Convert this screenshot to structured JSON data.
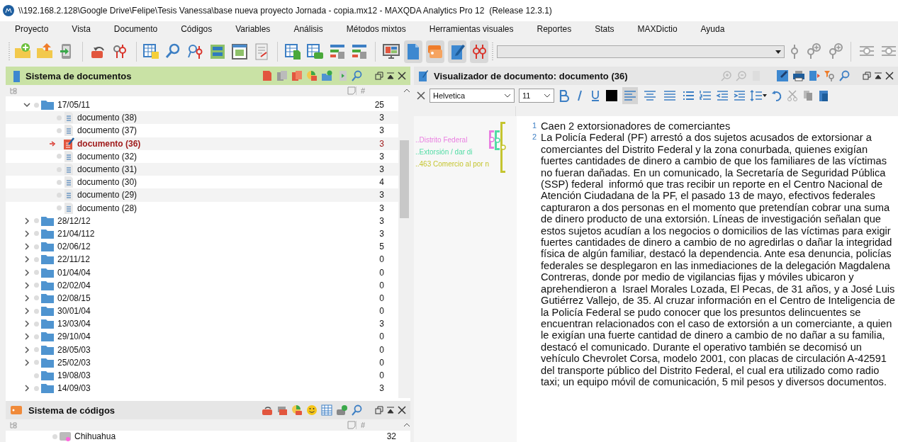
{
  "window": {
    "title": "\\\\192.168.2.128\\Google Drive\\Felipe\\Tesis Vanessa\\base nueva proyecto Jornada - copia.mx12 - MAXQDA Analytics Pro 12  (Release 12.3.1)"
  },
  "menu": [
    "Proyecto",
    "Vista",
    "Documento",
    "Códigos",
    "Variables",
    "Análisis",
    "Métodos mixtos",
    "Herramientas visuales",
    "Reportes",
    "Stats",
    "MAXDictio",
    "Ayuda"
  ],
  "document_system": {
    "title": "Sistema de documentos",
    "count_header": "#",
    "tree": [
      {
        "label": "17/05/11",
        "count": "25",
        "expanded": true,
        "has_children": true,
        "children": [
          {
            "label": "documento (38)",
            "count": "3",
            "active": false
          },
          {
            "label": "documento (37)",
            "count": "3",
            "active": false
          },
          {
            "label": "documento (36)",
            "count": "3",
            "active": true
          },
          {
            "label": "documento (32)",
            "count": "3",
            "active": false
          },
          {
            "label": "documento (31)",
            "count": "3",
            "active": false
          },
          {
            "label": "documento (30)",
            "count": "4",
            "active": false
          },
          {
            "label": "documento (29)",
            "count": "3",
            "active": false
          },
          {
            "label": "documento (28)",
            "count": "3",
            "active": false
          }
        ]
      },
      {
        "label": "28/12/12",
        "count": "3",
        "expanded": false,
        "has_children": true
      },
      {
        "label": "21/04/112",
        "count": "3",
        "expanded": false,
        "has_children": true
      },
      {
        "label": "02/06/12",
        "count": "5",
        "expanded": false,
        "has_children": true
      },
      {
        "label": "22/11/12",
        "count": "0",
        "expanded": false,
        "has_children": true
      },
      {
        "label": "01/04/04",
        "count": "0",
        "expanded": false,
        "has_children": true
      },
      {
        "label": "02/02/04",
        "count": "0",
        "expanded": false,
        "has_children": true
      },
      {
        "label": "02/08/15",
        "count": "0",
        "expanded": false,
        "has_children": true
      },
      {
        "label": "30/01/04",
        "count": "0",
        "expanded": false,
        "has_children": true
      },
      {
        "label": "13/03/04",
        "count": "3",
        "expanded": false,
        "has_children": true
      },
      {
        "label": "29/10/04",
        "count": "0",
        "expanded": false,
        "has_children": true
      },
      {
        "label": "28/05/03",
        "count": "0",
        "expanded": false,
        "has_children": true
      },
      {
        "label": "25/02/03",
        "count": "0",
        "expanded": false,
        "has_children": true
      },
      {
        "label": "19/08/03",
        "count": "0",
        "expanded": false,
        "has_children": false
      },
      {
        "label": "14/09/03",
        "count": "3",
        "expanded": false,
        "has_children": true
      }
    ]
  },
  "code_system": {
    "title": "Sistema de códigos",
    "count_header": "#",
    "tree": [
      {
        "label": "Chihuahua",
        "count": "32"
      }
    ]
  },
  "viewer": {
    "title": "Visualizador de documento: documento (36)",
    "font": "Helvetica",
    "size": "11",
    "alignments": [
      {
        "kind": "left",
        "selected": true
      },
      {
        "kind": "center",
        "selected": false
      },
      {
        "kind": "justify",
        "selected": false
      }
    ],
    "codes": [
      {
        "label": "..Distrito Federal",
        "color": "#e97fe0"
      },
      {
        "label": "..Extorsión / dar di",
        "color": "#52dca5"
      },
      {
        "label": "..463 Comercio al por n",
        "color": "#c5c530"
      }
    ],
    "paragraphs": [
      {
        "number": "1",
        "text": "Caen 2 extorsionadores de comerciantes"
      },
      {
        "number": "2",
        "text": "La Policía Federal (PF) arrestó a dos sujetos acusados de extorsionar a comerciantes del Distrito Federal y la zona conurbada, quienes exigían fuertes cantidades de dinero a cambio de que los familiares de las víctimas no fueran dañadas. En un comunicado, la Secretaría de Seguridad Pública (SSP) federal  informó que tras recibir un reporte en el Centro Nacional de Atención Ciudadana de la PF, el pasado 13 de mayo, efectivos federales capturaron a dos personas en el momento que pretendían cobrar una suma de dinero producto de una extorsión. Líneas de investigación señalan que estos sujetos acudían a los negocios o domicilios de las víctimas para exigir fuertes cantidades de dinero a cambio de no agredirlas o dañar la integridad física de algún familiar, destacó la dependencia. Ante esa denuncia, policías federales se desplegaron en las inmediaciones de la delegación Magdalena Contreras, donde por medio de vigilancias fijas y móviles ubicaron y aprehendieron a  Israel Morales Lozada, El Pecas, de 31 años, y a José Luis Gutiérrez Vallejo, de 35. Al cruzar información en el Centro de Inteligencia de la Policía Federal se pudo conocer que los presuntos delincuentes se encuentran relacionados con el caso de extorsión a un comerciante, a quien le exigían una fuerte cantidad de dinero a cambio de no dañar a su familia, destacó el comunicado. Durante el operativo también se decomisó un vehículo Chevrolet Corsa, modelo 2001, con placas de circulación A-42591 del transporte público del Distrito Federal, el cual era utilizado como radio taxi; un equipo móvil de comunicación, 5 mil pesos y diversos documentos."
      }
    ]
  }
}
